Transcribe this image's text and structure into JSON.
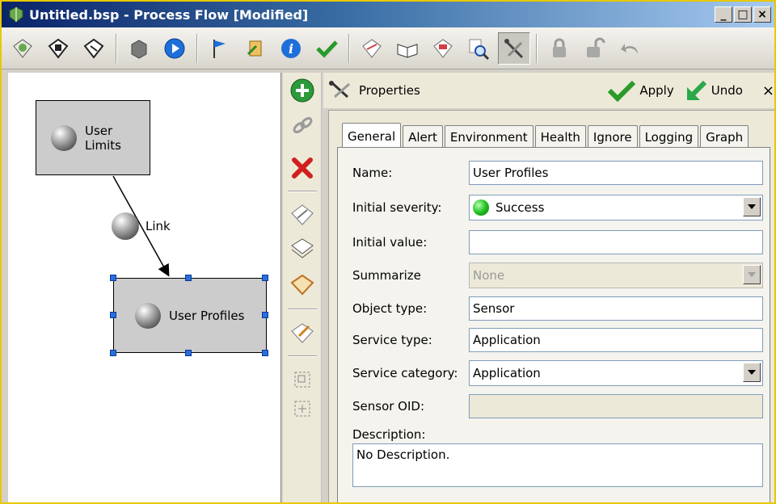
{
  "window": {
    "title": "Untitled.bsp - Process Flow [Modified]",
    "minimize": "_",
    "maximize": "□",
    "close": "×"
  },
  "toolbar": {
    "icons": [
      "open-icon",
      "save-icon",
      "save-as-icon",
      "stop-icon",
      "run-icon",
      "flag-icon",
      "script-icon",
      "info-icon",
      "check-icon",
      "edit-icon",
      "book-icon",
      "calendar-icon",
      "find-icon",
      "properties-icon",
      "lock-icon",
      "unlock-icon",
      "undo-icon"
    ]
  },
  "canvas": {
    "nodes": [
      {
        "label": "User Limits",
        "selected": false
      },
      {
        "label": "User Profiles",
        "selected": true
      }
    ],
    "link": {
      "label": "Link"
    }
  },
  "properties": {
    "header_label": "Properties",
    "apply_label": "Apply",
    "undo_label": "Undo",
    "close_label": "×",
    "tabs": [
      {
        "label": "General",
        "active": true
      },
      {
        "label": "Alert",
        "active": false
      },
      {
        "label": "Environment",
        "active": false
      },
      {
        "label": "Health",
        "active": false
      },
      {
        "label": "Ignore",
        "active": false
      },
      {
        "label": "Logging",
        "active": false
      },
      {
        "label": "Graph",
        "active": false
      }
    ],
    "fields": {
      "name": {
        "label": "Name:",
        "value": "User Profiles"
      },
      "initial_severity": {
        "label": "Initial severity:",
        "value": "Success",
        "status_color": "#22c022"
      },
      "initial_value": {
        "label": "Initial value:",
        "value": ""
      },
      "summarize": {
        "label": "Summarize",
        "value": "None",
        "disabled": true
      },
      "object_type": {
        "label": "Object type:",
        "value": "Sensor"
      },
      "service_type": {
        "label": "Service type:",
        "value": "Application"
      },
      "service_category": {
        "label": "Service category:",
        "value": "Application"
      },
      "sensor_oid": {
        "label": "Sensor OID:",
        "value": ""
      },
      "description": {
        "label": "Description:",
        "value": "No Description."
      }
    }
  },
  "colors": {
    "title_gradient_start": "#0a246a",
    "window_border": "#e8c800",
    "selection_handle": "#2a6edb"
  }
}
